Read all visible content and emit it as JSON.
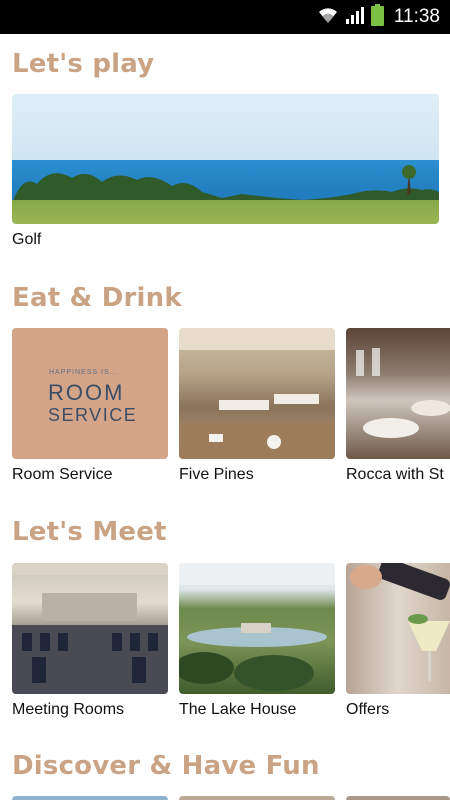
{
  "status_bar": {
    "time": "11:38",
    "colors": {
      "background": "#000000",
      "battery": "#7ac143"
    }
  },
  "theme": {
    "accent": "#c9a383",
    "text": "#111111"
  },
  "sections": [
    {
      "title": "Let's play",
      "cards": [
        {
          "label": "Golf",
          "image": "golf-course-sea"
        }
      ]
    },
    {
      "title": "Eat & Drink",
      "cards": [
        {
          "label": "Room Service",
          "image": "room-service-logo"
        },
        {
          "label": "Five Pines",
          "image": "restaurant-interior"
        },
        {
          "label": "Rocca with St",
          "image": "dining-table"
        }
      ]
    },
    {
      "title": "Let's Meet",
      "cards": [
        {
          "label": "Meeting Rooms",
          "image": "meeting-room-chairs"
        },
        {
          "label": "The Lake House",
          "image": "lake-house-aerial"
        },
        {
          "label": "Offers",
          "image": "cocktail-pour"
        }
      ]
    },
    {
      "title": "Discover & Have Fun",
      "cards": []
    }
  ],
  "room_service_logo": {
    "small": "HAPPINESS IS...",
    "line1": "ROOM",
    "line2": "SERVICE"
  }
}
